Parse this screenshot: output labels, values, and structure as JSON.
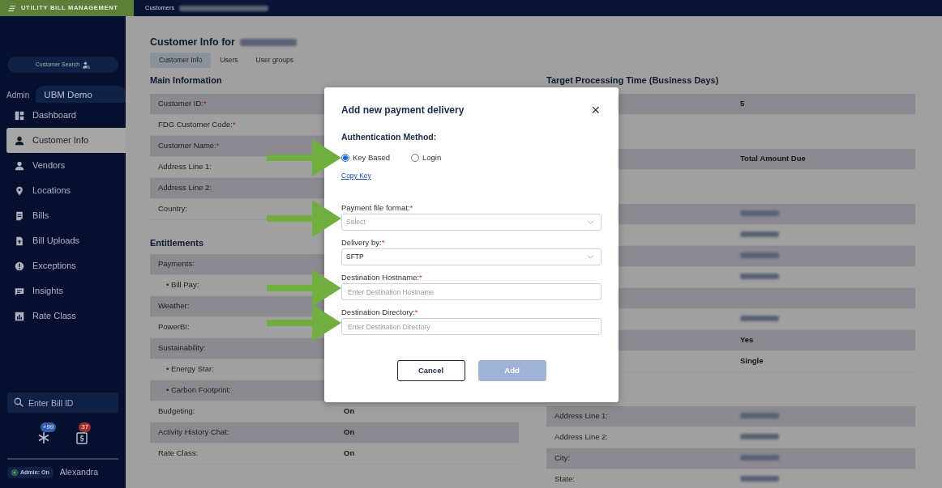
{
  "header": {
    "logo": "UTILITY BILL MANAGEMENT",
    "breadcrumb": "Customers",
    "breadcrumb_redacted": true
  },
  "sidebar": {
    "customer_search": "Customer Search",
    "tabs": [
      {
        "label": "Admin",
        "selected": false
      },
      {
        "label": "UBM Demo",
        "selected": true
      }
    ],
    "items": [
      {
        "label": "Dashboard",
        "selected": false
      },
      {
        "label": "Customer Info",
        "selected": true
      },
      {
        "label": "Vendors",
        "selected": false
      },
      {
        "label": "Locations",
        "selected": false
      },
      {
        "label": "Bills",
        "selected": false
      },
      {
        "label": "Bill Uploads",
        "selected": false
      },
      {
        "label": "Exceptions",
        "selected": false
      },
      {
        "label": "Insights",
        "selected": false
      },
      {
        "label": "Rate Class",
        "selected": false
      }
    ],
    "bill_search": {
      "placeholder": "Enter Bill ID"
    },
    "badges": [
      {
        "count": "+99",
        "color": "#2f5fb0"
      },
      {
        "count": "37",
        "color": "#a03030"
      }
    ],
    "admin_toggle": {
      "label": "Admin: On",
      "on": true
    },
    "user": "Alexandra"
  },
  "page": {
    "title": "Customer Info for",
    "title_redacted": true,
    "tabs": [
      {
        "label": "Customer Info",
        "selected": true
      },
      {
        "label": "Users",
        "selected": false
      },
      {
        "label": "User groups",
        "selected": false
      }
    ],
    "left": [
      {
        "heading": "Main Information",
        "rows": [
          {
            "label": "Customer ID:",
            "required_mark": "*"
          },
          {
            "label": "FDG Customer Code:",
            "required_mark": "*"
          },
          {
            "label": "Customer Name:",
            "required_mark": "*"
          },
          {
            "label": "Address Line 1:"
          },
          {
            "label": "Address Line 2:"
          },
          {
            "label": "Country:"
          }
        ]
      },
      {
        "heading": "Entitlements",
        "rows": [
          {
            "label": "Payments:"
          },
          {
            "label": "Bill Pay:",
            "bullet": "•"
          },
          {
            "label": "Weather:"
          },
          {
            "label": "PowerBI:"
          },
          {
            "label": "Sustainability:"
          },
          {
            "label": "Energy Star:",
            "bullet": "•"
          },
          {
            "label": "Carbon Footprint:",
            "bullet": "•"
          },
          {
            "label": "Budgeting:",
            "value": "On"
          },
          {
            "label": "Activity History Chat:",
            "value": "On"
          },
          {
            "label": "Rate Class:",
            "value": "On"
          }
        ]
      }
    ],
    "right": [
      {
        "heading": "Target Processing Time (Business Days)",
        "rows": [
          {
            "value": "5"
          }
        ]
      },
      {
        "rows": [
          {
            "value": "Total Amount Due"
          }
        ]
      },
      {
        "rows": [
          {
            "redacted": true
          },
          {
            "redacted": true
          },
          {
            "redacted": true
          },
          {
            "redacted": true
          },
          {},
          {
            "redacted": true
          },
          {
            "value": "Yes"
          },
          {
            "value": "Single"
          }
        ]
      },
      {
        "rows": [
          {
            "label": "Address Line 1:",
            "redacted": true
          },
          {
            "label": "Address Line 2:",
            "redacted": true
          },
          {
            "label": "City:",
            "redacted": true
          },
          {
            "label": "State:",
            "redacted": true
          }
        ]
      }
    ]
  },
  "modal": {
    "title": "Add new payment delivery",
    "close": "×",
    "auth_label": "Authentication Method:",
    "auth_marked": true,
    "auth_options": [
      {
        "label": "Key Based",
        "selected": true
      },
      {
        "label": "Login",
        "selected": false
      }
    ],
    "link": "Copy Key",
    "fields": [
      {
        "kind": "select",
        "label": "Payment file format:",
        "required_mark": "*",
        "placeholder": "Select",
        "marked": true
      },
      {
        "kind": "select",
        "label": "Delivery by:",
        "required_mark": "*",
        "value": "SFTP"
      },
      {
        "kind": "text",
        "label": "Destination Hostname:",
        "required_mark": "*",
        "placeholder": "Enter Destination Hostname",
        "marked": true
      },
      {
        "kind": "text",
        "label": "Destination Directory:",
        "required_mark": "*",
        "placeholder": "Enter Destination Directory",
        "marked": true
      }
    ],
    "buttons": [
      {
        "label": "Cancel",
        "kind": "secondary",
        "disabled": false
      },
      {
        "label": "Add",
        "kind": "primary",
        "disabled": true
      }
    ]
  }
}
